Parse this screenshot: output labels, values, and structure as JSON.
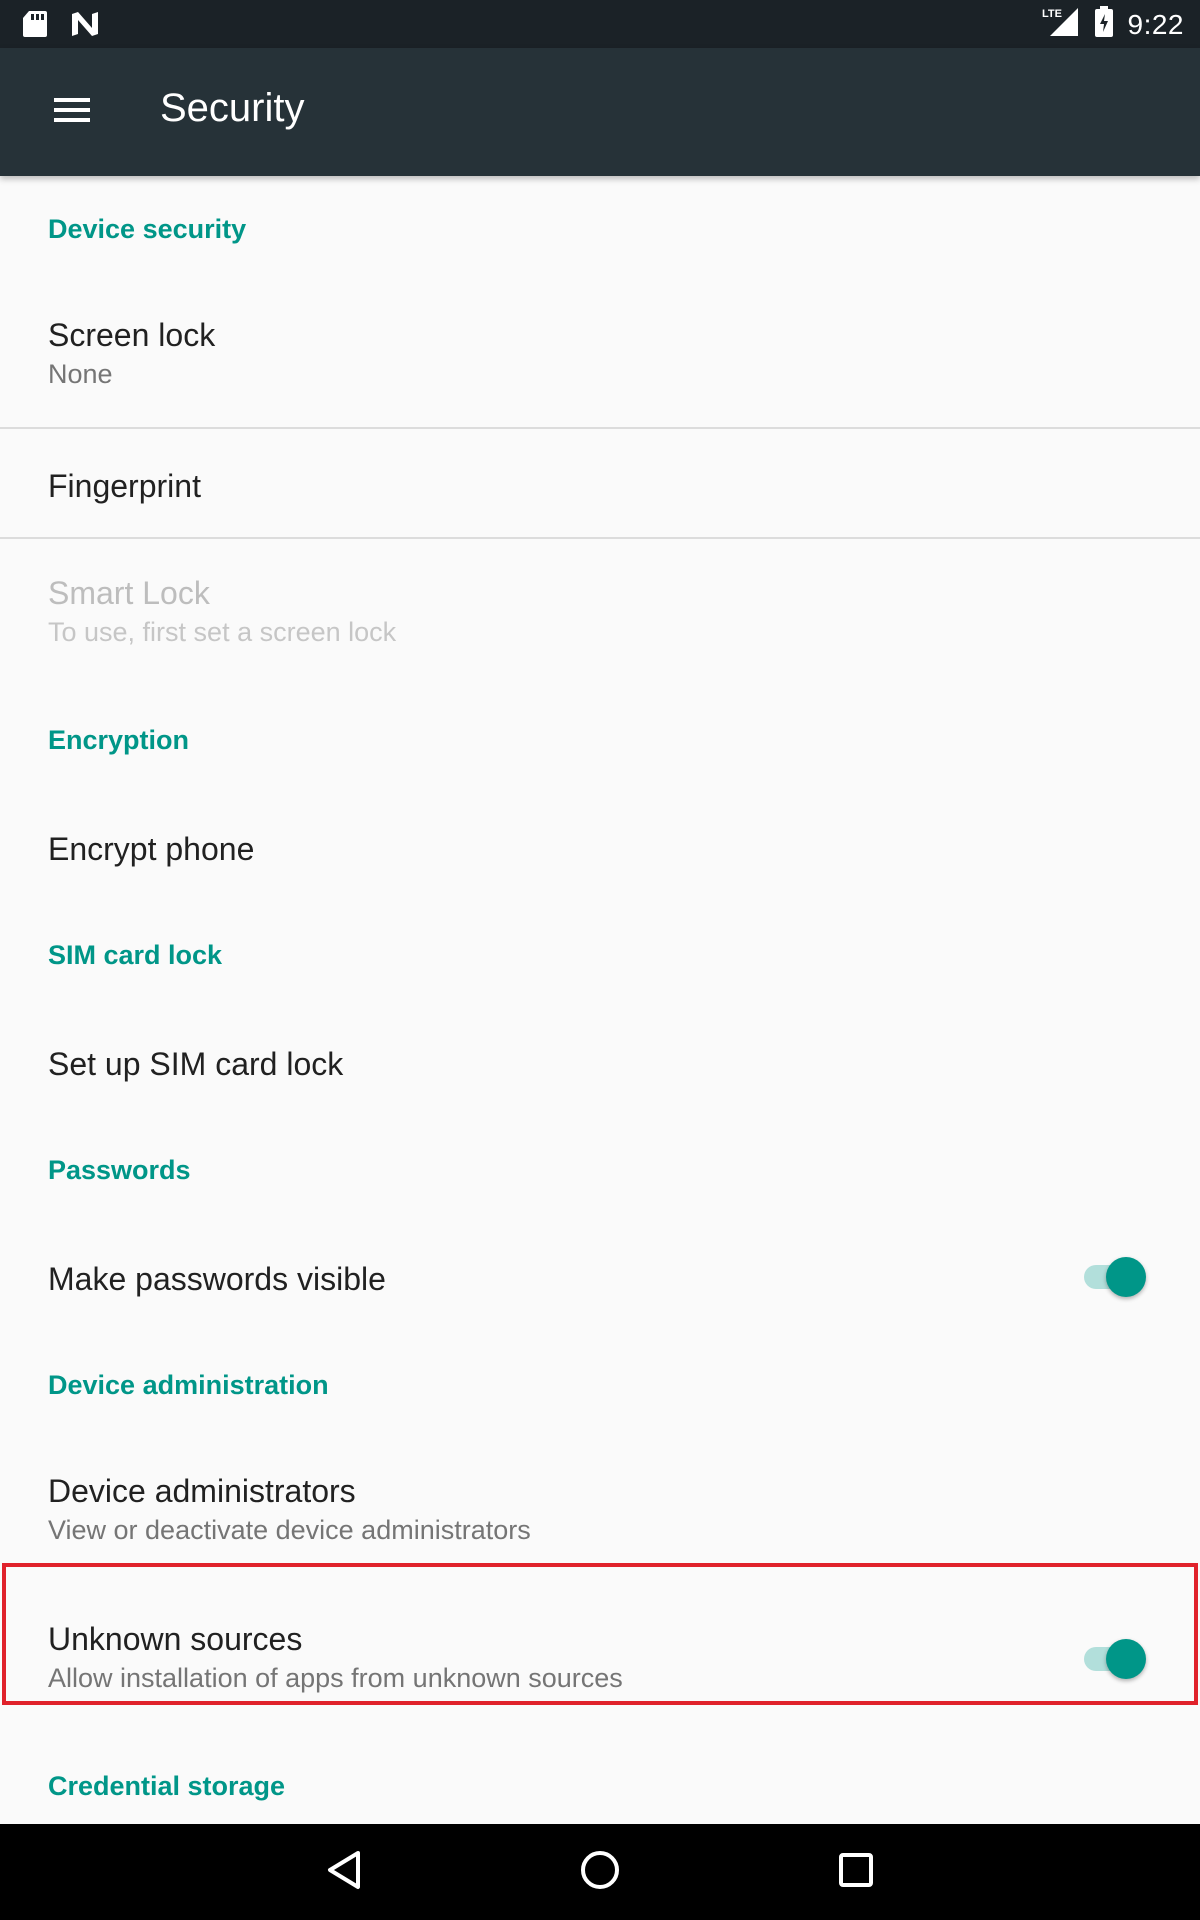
{
  "status_bar": {
    "time": "9:22",
    "network": "LTE",
    "icons": [
      "sd-card-icon",
      "n-logo-icon",
      "lte-signal-icon",
      "battery-icon"
    ]
  },
  "app_bar": {
    "title": "Security",
    "menu_icon": "hamburger-menu-icon"
  },
  "sections": {
    "device_security": {
      "header": "Device security",
      "screen_lock": {
        "title": "Screen lock",
        "summary": "None"
      },
      "fingerprint": {
        "title": "Fingerprint"
      },
      "smart_lock": {
        "title": "Smart Lock",
        "summary": "To use, first set a screen lock",
        "enabled": false
      }
    },
    "encryption": {
      "header": "Encryption",
      "encrypt_phone": {
        "title": "Encrypt phone"
      }
    },
    "sim_card_lock": {
      "header": "SIM card lock",
      "setup": {
        "title": "Set up SIM card lock"
      }
    },
    "passwords": {
      "header": "Passwords",
      "make_visible": {
        "title": "Make passwords visible",
        "checked": true
      }
    },
    "device_administration": {
      "header": "Device administration",
      "administrators": {
        "title": "Device administrators",
        "summary": "View or deactivate device administrators"
      },
      "unknown_sources": {
        "title": "Unknown sources",
        "summary": "Allow installation of apps from unknown sources",
        "checked": true,
        "highlighted": true
      }
    },
    "credential_storage": {
      "header": "Credential storage"
    }
  },
  "nav_bar": {
    "icons": [
      "back-icon",
      "home-icon",
      "recents-icon"
    ]
  },
  "colors": {
    "accent": "#009688",
    "app_bar": "#263238",
    "status_bar": "#1b2227",
    "background": "#fafafa",
    "highlight": "#e0222b"
  }
}
